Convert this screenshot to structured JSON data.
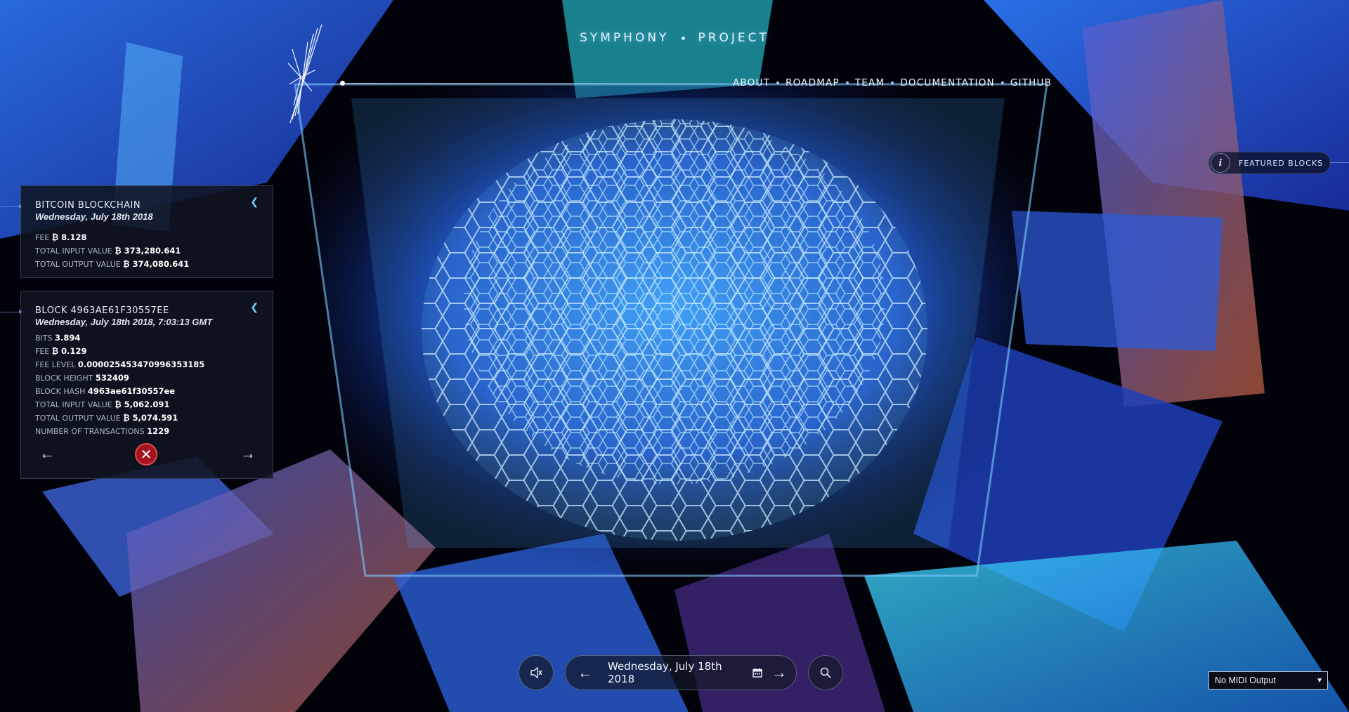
{
  "header": {
    "brand_left": "SYMPHONY",
    "brand_right": "PROJECT",
    "nav": [
      "ABOUT",
      "ROADMAP",
      "TEAM",
      "DOCUMENTATION",
      "GITHUB"
    ]
  },
  "featured": {
    "icon": "info-icon",
    "label": "FEATURED BLOCKS"
  },
  "blockchain_panel": {
    "title": "BITCOIN BLOCKCHAIN",
    "date": "Wednesday, July 18th 2018",
    "rows": [
      {
        "label": "FEE",
        "value": "₿ 8.128"
      },
      {
        "label": "TOTAL INPUT VALUE",
        "value": "₿ 373,280.641"
      },
      {
        "label": "TOTAL OUTPUT VALUE",
        "value": "₿ 374,080.641"
      }
    ]
  },
  "block_panel": {
    "title": "BLOCK 4963AE61F30557EE",
    "date": "Wednesday, July 18th 2018, 7:03:13 GMT",
    "rows": [
      {
        "label": "BITS",
        "value": "3.894"
      },
      {
        "label": "FEE",
        "value": "₿ 0.129"
      },
      {
        "label": "FEE LEVEL",
        "value": "0.000025453470996353185"
      },
      {
        "label": "BLOCK HEIGHT",
        "value": "532409"
      },
      {
        "label": "BLOCK HASH",
        "value": "4963ae61f30557ee"
      },
      {
        "label": "TOTAL INPUT VALUE",
        "value": "₿ 5,062.091"
      },
      {
        "label": "TOTAL OUTPUT VALUE",
        "value": "₿ 5,074.591"
      },
      {
        "label": "NUMBER OF TRANSACTIONS",
        "value": "1229"
      }
    ]
  },
  "controls": {
    "date": "Wednesday, July 18th 2018",
    "midi": "No MIDI Output"
  },
  "colors": {
    "accent": "#68d6ff",
    "close": "#a51520",
    "panel_bg": "#10141f"
  }
}
